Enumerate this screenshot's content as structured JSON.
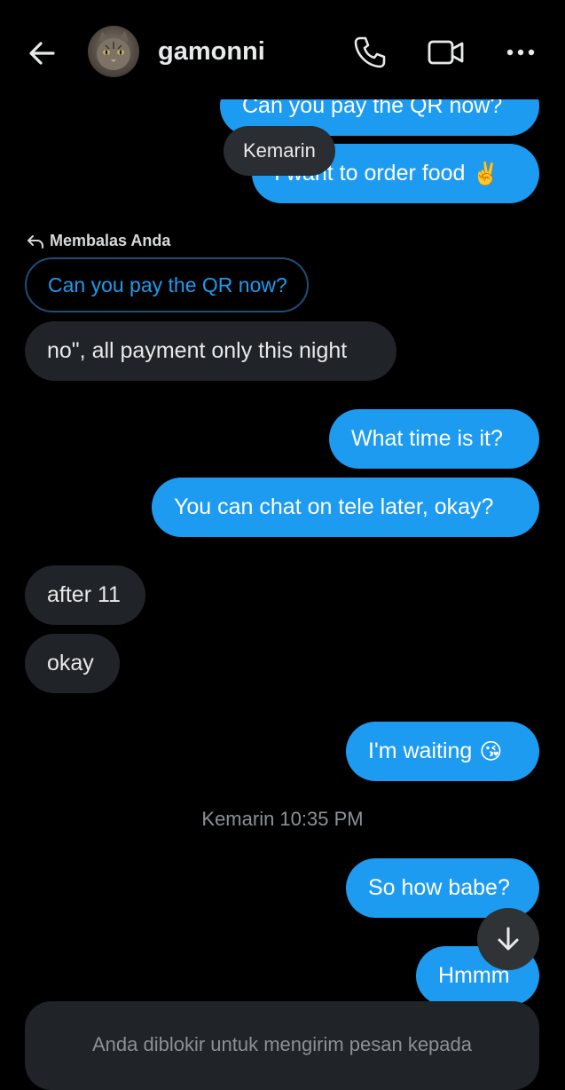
{
  "header": {
    "username": "gamonni",
    "back_icon": "arrow-left-icon",
    "phone_icon": "phone-icon",
    "video_icon": "video-camera-icon",
    "more_icon": "more-horizontal-icon"
  },
  "tooltip": "Kemarin",
  "messages": {
    "m1": "Can you pay the QR now?",
    "m2": "I want to order food",
    "m2_emoji": "✌️",
    "reply_label": "Membalas Anda",
    "quoted": "Can you pay the QR now?",
    "m3": "no\", all payment only this night",
    "m4": "What time is it?",
    "m5": "You can chat on tele later, okay?",
    "m6": "after 11",
    "m7": "okay",
    "m8": "I'm waiting",
    "m8_emoji": "😘",
    "m9": "So how babe?",
    "m10": "Hmmm"
  },
  "timestamp": "Kemarin 10:35 PM",
  "blocked_notice": "Anda diblokir untuk mengirim pesan kepada",
  "colors": {
    "background": "#000000",
    "outgoing": "#1d9bf0",
    "incoming": "#202327",
    "muted": "#8b9196"
  }
}
